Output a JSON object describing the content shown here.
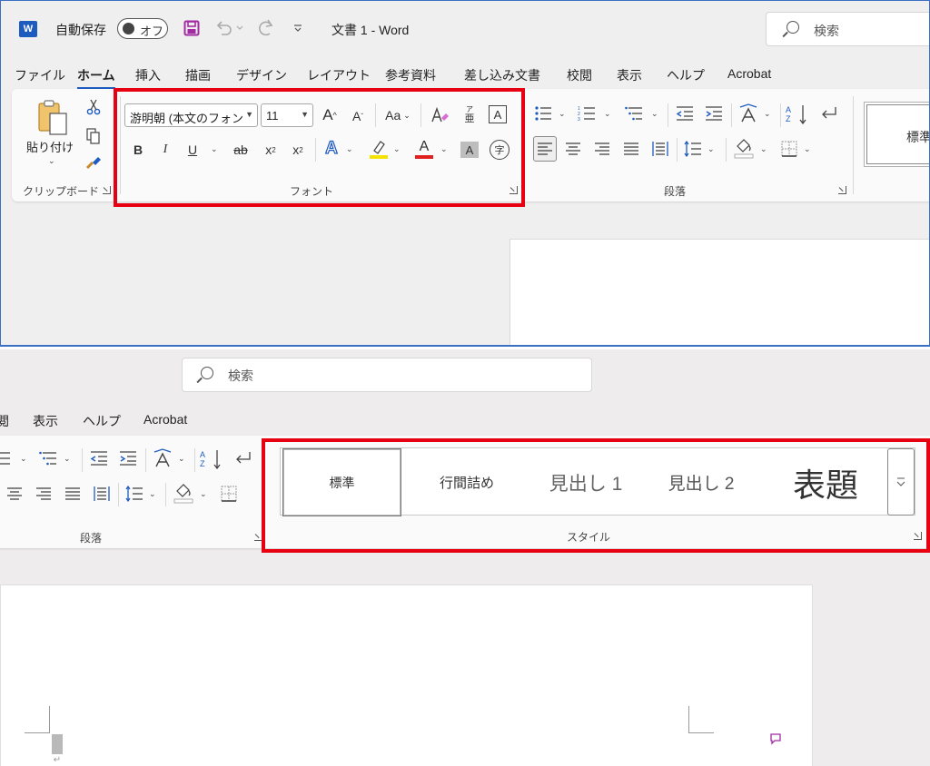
{
  "colors": {
    "accent": "#1e5bbf",
    "highlight_box": "#e60012",
    "highlighter_yellow": "#f4e200",
    "font_color_red": "#e02020",
    "save_purple": "#a22ba3"
  },
  "titlebar": {
    "app_icon": "word-logo-icon",
    "app_icon_text": "W",
    "autosave_label": "自動保存",
    "autosave_toggle": "オフ",
    "document_title": "文書 1  -  Word",
    "search_placeholder": "検索"
  },
  "menu": [
    "ファイル",
    "ホーム",
    "挿入",
    "描画",
    "デザイン",
    "レイアウト",
    "参考資料",
    "差し込み文書",
    "校閲",
    "表示",
    "ヘルプ",
    "Acrobat"
  ],
  "active_menu": "ホーム",
  "clipboard": {
    "paste_label": "貼り付け",
    "group_label": "クリップボード"
  },
  "font": {
    "font_name": "游明朝 (本文のフォン",
    "font_size": "11",
    "change_case": "Aa",
    "grow_font": "A",
    "shrink_font": "A",
    "bold": "B",
    "italic": "I",
    "underline": "U",
    "strikethrough": "ab",
    "subscript": "x",
    "subscript_mark": "2",
    "superscript": "x",
    "superscript_mark": "2",
    "text_effects": "A",
    "font_color": "A",
    "char_shading": "A",
    "enclose": "字",
    "phonetic_top": "ア",
    "phonetic_bottom": "亜",
    "char_border": "A",
    "group_label": "フォント"
  },
  "paragraph": {
    "group_label": "段落",
    "sort": "A Z"
  },
  "styles_preview_partial": "標準",
  "panel2": {
    "search_placeholder": "検索",
    "menu": [
      "閲",
      "表示",
      "ヘルプ",
      "Acrobat"
    ],
    "paragraph_label": "段落",
    "styles_label": "スタイル",
    "styles": [
      "標準",
      "行間詰め",
      "見出し 1",
      "見出し 2",
      "表題"
    ],
    "selected_style": "標準"
  }
}
